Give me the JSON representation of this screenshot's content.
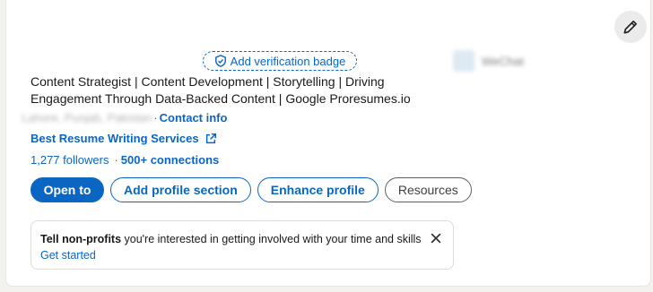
{
  "profile": {
    "verification_label": "Add verification badge",
    "company_blurred": "WeChat",
    "headline": "Content Strategist | Content Development | Storytelling | Driving Engagement Through Data-Backed Content | Google Proresumes.io",
    "location_blurred": "Lahore, Punjab, Pakistan",
    "location_sep": "·",
    "contact_label": "Contact info",
    "website_label": "Best Resume Writing Services",
    "followers": "1,277 followers",
    "stats_sep": "·",
    "connections": "500+ connections"
  },
  "actions": {
    "open_to": "Open to",
    "add_section": "Add profile section",
    "enhance": "Enhance profile",
    "resources": "Resources"
  },
  "notice": {
    "bold": "Tell non-profits",
    "rest": " you're interested in getting involved with your time and skills",
    "cta": "Get started"
  },
  "icons": {
    "edit": "pencil-icon",
    "verify": "shield-check-icon",
    "external": "external-link-icon",
    "close": "close-icon"
  },
  "colors": {
    "brand": "#0a66c2",
    "text": "#191919"
  }
}
